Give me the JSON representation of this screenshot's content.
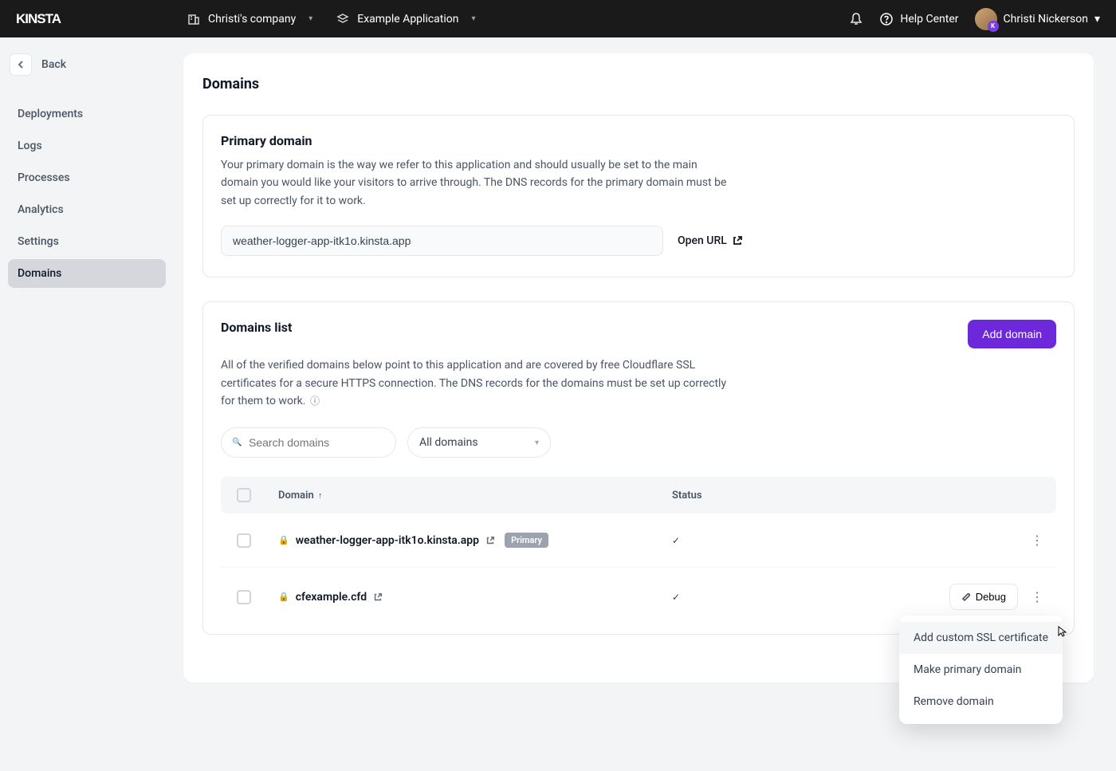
{
  "header": {
    "logo": "KINSTA",
    "company_label": "Christi's company",
    "app_label": "Example Application",
    "help_label": "Help Center",
    "user_name": "Christi Nickerson"
  },
  "sidebar": {
    "back_label": "Back",
    "items": [
      {
        "label": "Deployments"
      },
      {
        "label": "Logs"
      },
      {
        "label": "Processes"
      },
      {
        "label": "Analytics"
      },
      {
        "label": "Settings"
      },
      {
        "label": "Domains"
      }
    ]
  },
  "page": {
    "title": "Domains"
  },
  "primary_section": {
    "title": "Primary domain",
    "description": "Your primary domain is the way we refer to this application and should usually be set to the main domain you would like your visitors to arrive through. The DNS records for the primary domain must be set up correctly for it to work.",
    "domain_value": "weather-logger-app-itk1o.kinsta.app",
    "open_url_label": "Open URL"
  },
  "list_section": {
    "title": "Domains list",
    "description": "All of the verified domains below point to this application and are covered by free Cloudflare SSL certificates for a secure HTTPS connection. The DNS records for the domains must be set up correctly for them to work.",
    "add_button": "Add domain",
    "search_placeholder": "Search domains",
    "filter_label": "All domains",
    "columns": {
      "domain": "Domain",
      "status": "Status"
    },
    "rows": [
      {
        "domain": "weather-logger-app-itk1o.kinsta.app",
        "primary": true,
        "status": "ok"
      },
      {
        "domain": "cfexample.cfd",
        "primary": false,
        "status": "ok",
        "debug": true
      }
    ],
    "debug_label": "Debug",
    "primary_badge": "Primary"
  },
  "dropdown": {
    "items": [
      "Add custom SSL certificate",
      "Make primary domain",
      "Remove domain"
    ]
  }
}
